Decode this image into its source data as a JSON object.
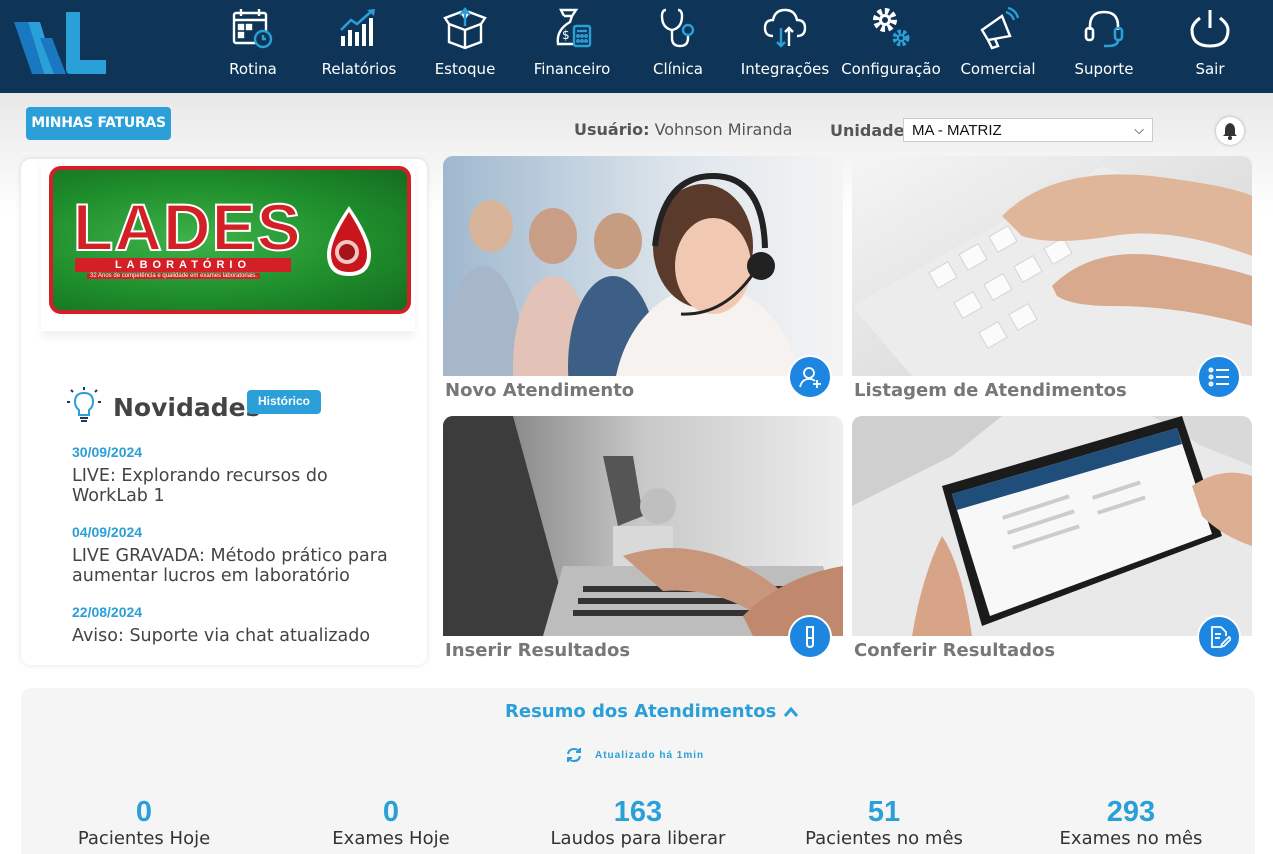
{
  "nav": {
    "items": [
      {
        "label": "Rotina",
        "icon": "calendar-icon"
      },
      {
        "label": "Relatórios",
        "icon": "bar-chart-icon"
      },
      {
        "label": "Estoque",
        "icon": "box-icon"
      },
      {
        "label": "Financeiro",
        "icon": "money-bag-icon"
      },
      {
        "label": "Clínica",
        "icon": "stethoscope-icon"
      },
      {
        "label": "Integrações",
        "icon": "cloud-sync-icon"
      },
      {
        "label": "Configuração",
        "icon": "gears-icon"
      },
      {
        "label": "Comercial",
        "icon": "megaphone-icon"
      },
      {
        "label": "Suporte",
        "icon": "headset-icon"
      },
      {
        "label": "Sair",
        "icon": "power-icon"
      }
    ]
  },
  "header": {
    "faturas_label": "MINHAS FATURAS",
    "usuario_label": "Usuário:",
    "usuario_name": "Vohnson Miranda",
    "unidade_label": "Unidade:",
    "unidade_value": "MA - MATRIZ"
  },
  "brand": {
    "name": "LADES",
    "subtitle": "LABORATÓRIO",
    "tagline": "32 Anos de competência e qualidade em exames laboratoriais."
  },
  "novidades": {
    "title": "Novidades",
    "historico_label": "Histórico",
    "items": [
      {
        "date": "30/09/2024",
        "text": "LIVE: Explorando recursos do WorkLab 1"
      },
      {
        "date": "04/09/2024",
        "text": "LIVE GRAVADA: Método prático para aumentar lucros em laboratório"
      },
      {
        "date": "22/08/2024",
        "text": "Aviso: Suporte via chat atualizado"
      }
    ]
  },
  "tiles": [
    {
      "label": "Novo Atendimento",
      "icon": "add-user-icon"
    },
    {
      "label": "Listagem de  Atendimentos",
      "icon": "list-icon"
    },
    {
      "label": "Inserir Resultados",
      "icon": "test-tube-icon"
    },
    {
      "label": "Conferir Resultados",
      "icon": "check-document-icon"
    }
  ],
  "resumo": {
    "title": "Resumo dos Atendimentos",
    "updated": "Atualizado há 1min",
    "stats": [
      {
        "value": "0",
        "label": "Pacientes Hoje"
      },
      {
        "value": "0",
        "label": "Exames Hoje"
      },
      {
        "value": "163",
        "label": "Laudos para liberar"
      },
      {
        "value": "51",
        "label": "Pacientes no mês"
      },
      {
        "value": "293",
        "label": "Exames no mês"
      }
    ]
  },
  "colors": {
    "nav_bg": "#0e3557",
    "accent": "#2a9fd8",
    "fab": "#1c86e0"
  }
}
